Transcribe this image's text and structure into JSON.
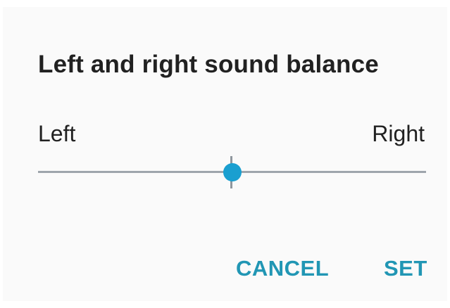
{
  "dialog": {
    "title": "Left and right sound balance",
    "left_label": "Left",
    "right_label": "Right",
    "balance_slider": {
      "min": 0,
      "max": 1,
      "value": 0.5
    },
    "cancel_label": "CANCEL",
    "set_label": "SET"
  },
  "colors": {
    "accent": "#1a9fd0",
    "button_text": "#2196b4",
    "track": "#9ea5ac"
  }
}
